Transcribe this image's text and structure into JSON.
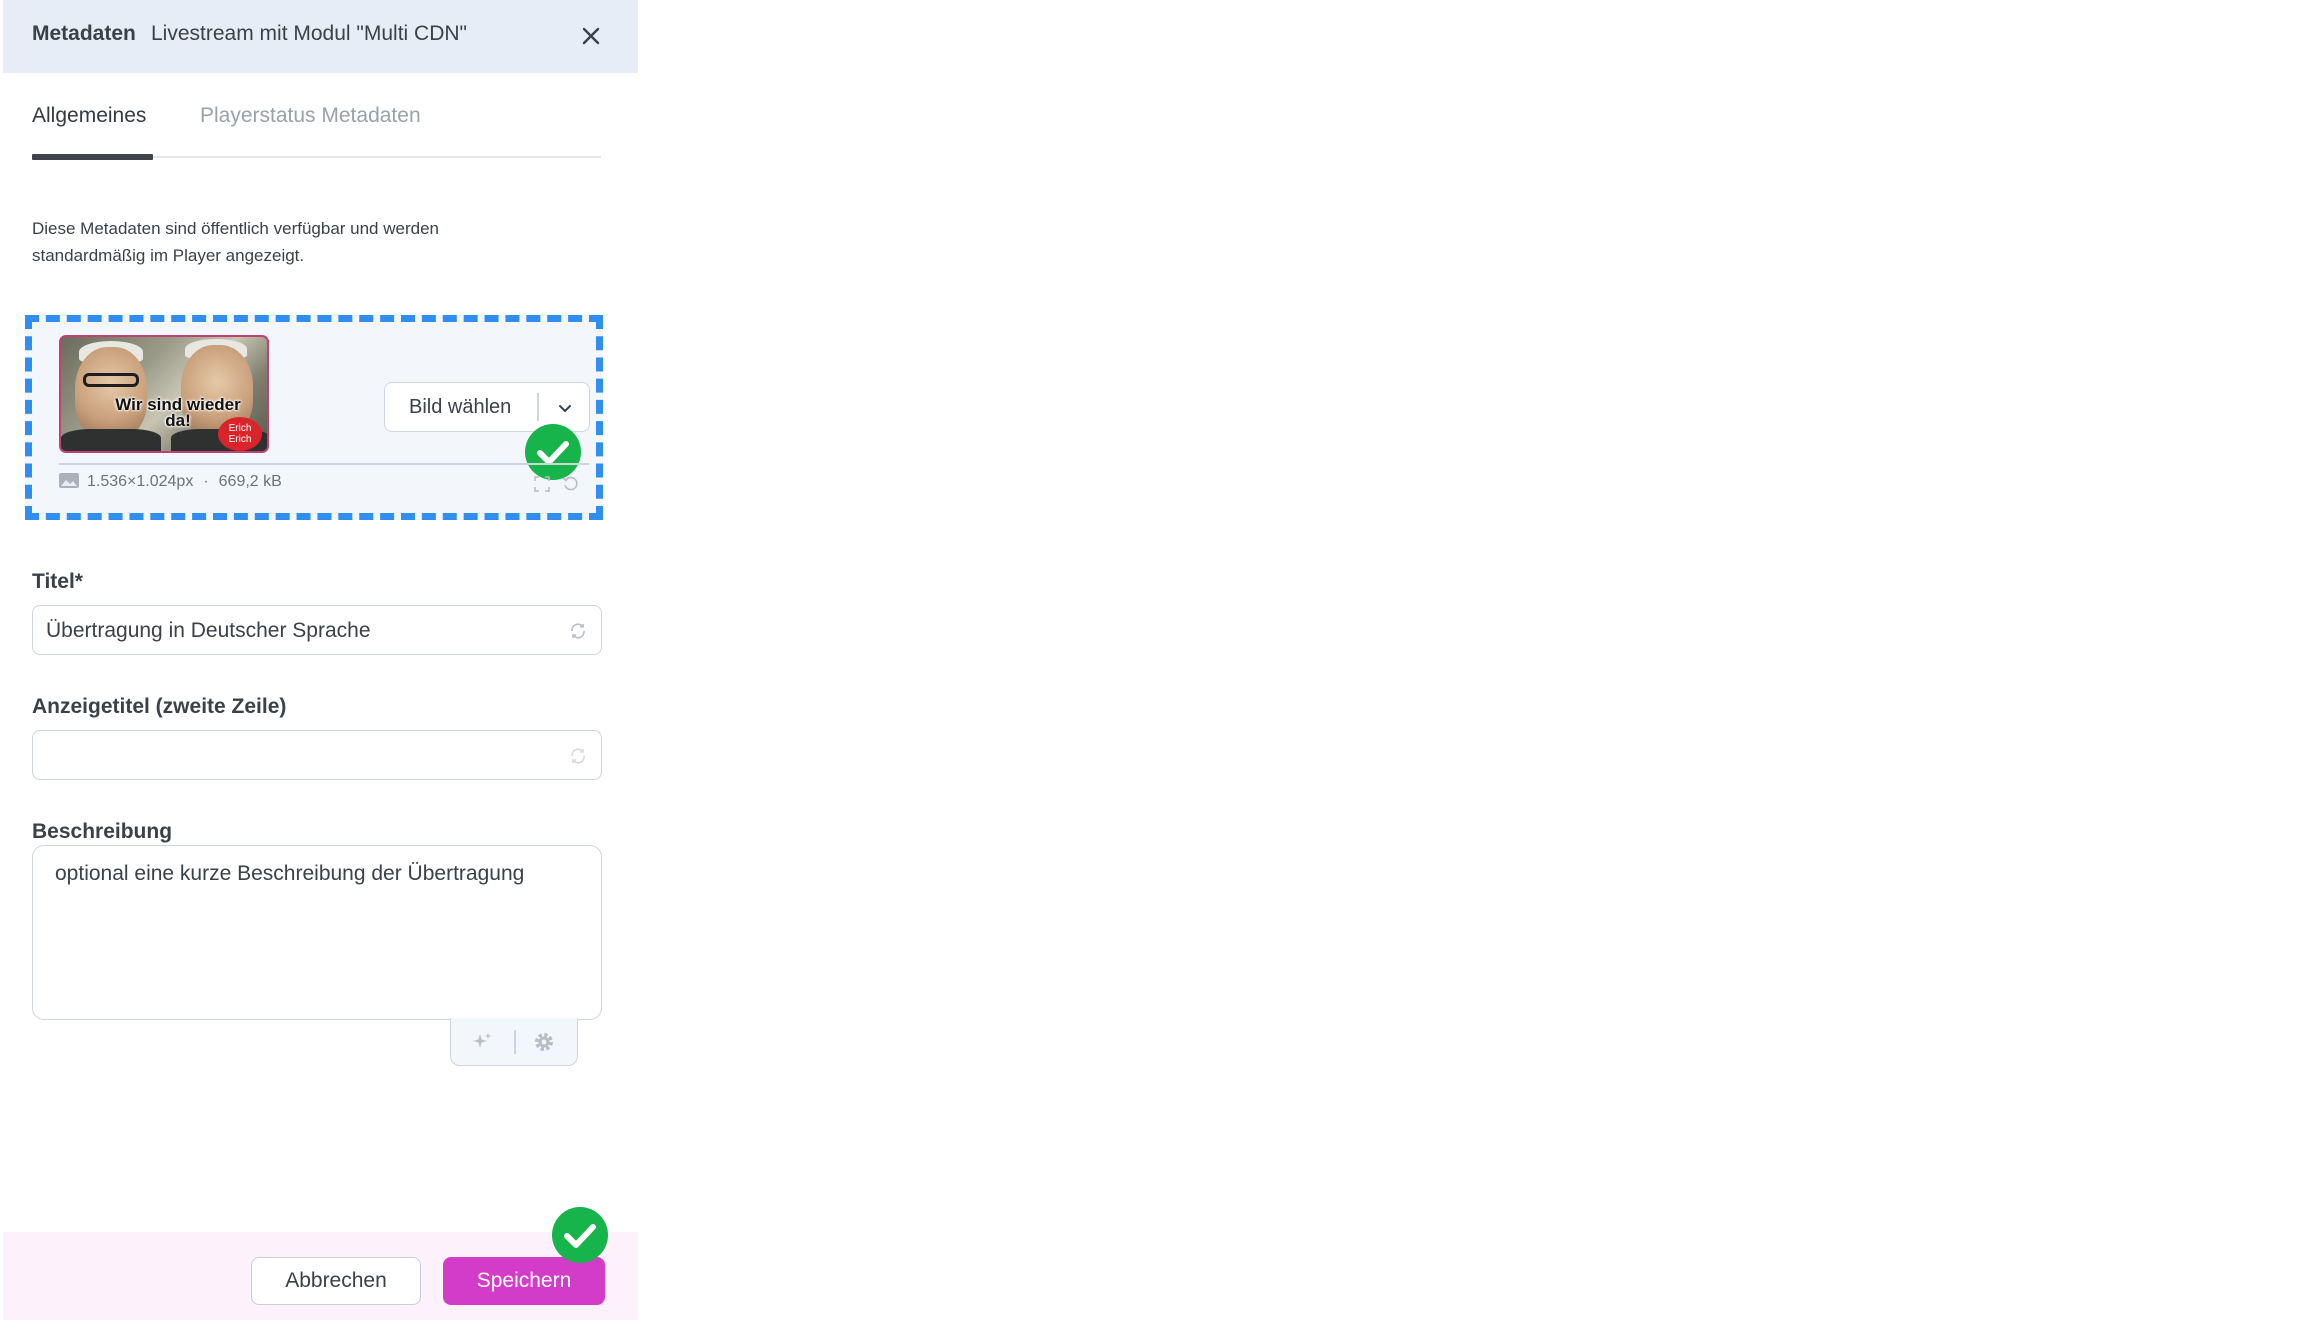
{
  "header": {
    "title": "Metadaten",
    "subtitle": "Livestream mit Modul \"Multi CDN\"",
    "close_icon": "close-icon"
  },
  "tabs": [
    {
      "label": "Allgemeines",
      "active": true
    },
    {
      "label": "Playerstatus Metadaten",
      "active": false
    }
  ],
  "info_text": "Diese Metadaten sind öffentlich verfügbar und werden standardmäßig im Player angezeigt.",
  "image": {
    "overlay_text": "Wir sind wieder da!",
    "badge_text": "Erich Erich",
    "choose_label": "Bild wählen",
    "dimensions": "1.536×1.024px",
    "separator": "·",
    "file_size": "669,2 kB",
    "icons": [
      "image-icon",
      "fullscreen-icon",
      "reset-icon",
      "chevron-down-icon"
    ]
  },
  "fields": {
    "title": {
      "label": "Titel*",
      "value": "Übertragung in Deutscher Sprache"
    },
    "display_title": {
      "label": "Anzeigetitel (zweite Zeile)",
      "value": ""
    },
    "description": {
      "label": "Beschreibung",
      "value": "optional eine kurze Beschreibung der Übertragung"
    }
  },
  "footer": {
    "cancel_label": "Abbrechen",
    "save_label": "Speichern"
  },
  "colors": {
    "header_bg": "#e7edf6",
    "accent_blue": "#2f8ef0",
    "save_button": "#d23cc8",
    "check_green": "#16b44a",
    "footer_bg": "#fdf1fb"
  }
}
